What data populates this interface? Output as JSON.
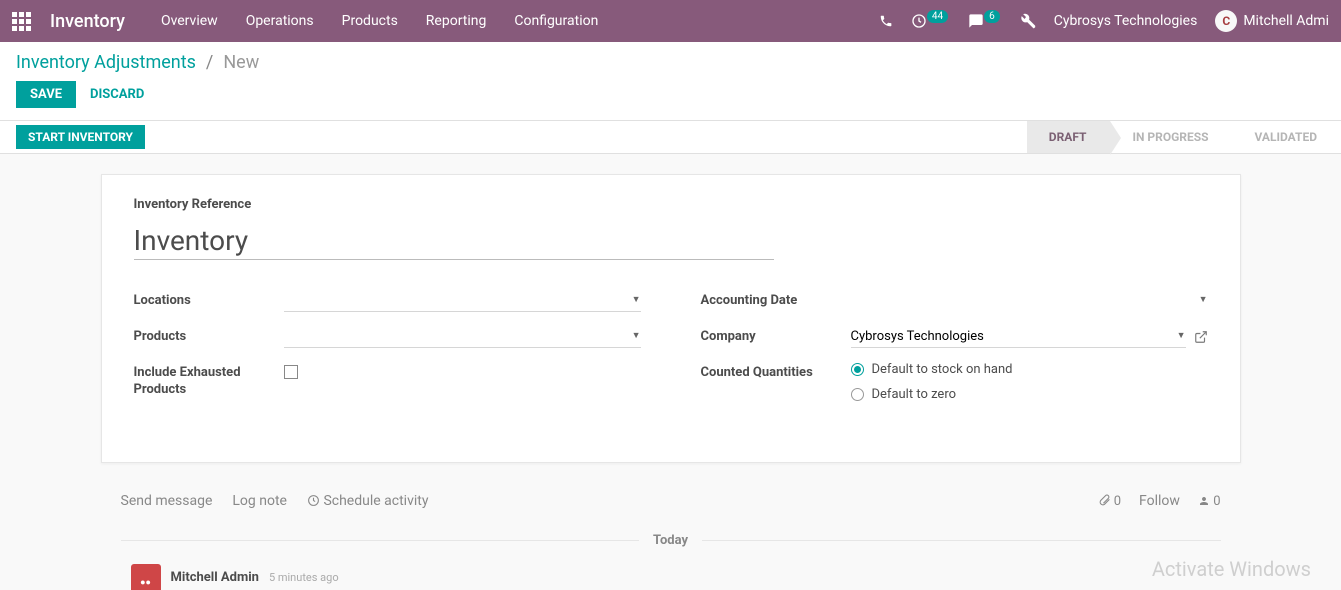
{
  "topbar": {
    "app_name": "Inventory",
    "nav": [
      "Overview",
      "Operations",
      "Products",
      "Reporting",
      "Configuration"
    ],
    "activity_badge": "44",
    "msg_badge": "6",
    "company": "Cybrosys Technologies",
    "user": "Mitchell Admi",
    "avatar_letter": "C"
  },
  "breadcrumb": {
    "root": "Inventory Adjustments",
    "sep": "/",
    "current": "New"
  },
  "actions": {
    "save": "SAVE",
    "discard": "DISCARD",
    "start": "START INVENTORY"
  },
  "status": {
    "draft": "DRAFT",
    "in_progress": "IN PROGRESS",
    "validated": "VALIDATED"
  },
  "form": {
    "ref_label": "Inventory Reference",
    "ref_value": "Inventory",
    "locations_label": "Locations",
    "locations_value": "",
    "products_label": "Products",
    "products_value": "",
    "include_exhausted_label": "Include Exhausted Products",
    "accounting_date_label": "Accounting Date",
    "accounting_date_value": "",
    "company_label": "Company",
    "company_value": "Cybrosys Technologies",
    "counted_label": "Counted Quantities",
    "radio_stock": "Default to stock on hand",
    "radio_zero": "Default to zero"
  },
  "chatter": {
    "send": "Send message",
    "log": "Log note",
    "schedule": "Schedule activity",
    "attach_count": "0",
    "follow": "Follow",
    "follower_count": "0",
    "today": "Today",
    "author": "Mitchell Admin",
    "time": "5 minutes ago"
  },
  "watermark": "Activate Windows"
}
